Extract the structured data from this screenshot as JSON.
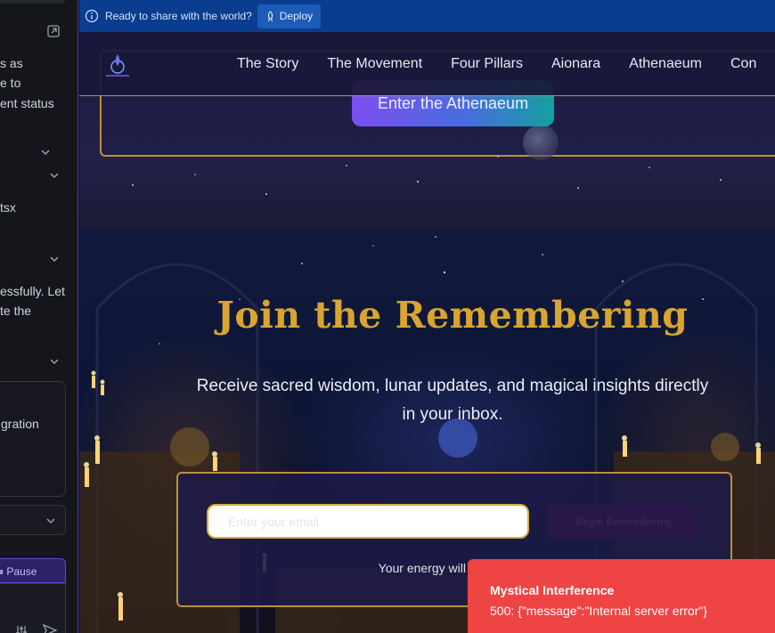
{
  "left_panel": {
    "lines": [
      "s as",
      "e to",
      "ent status",
      "tsx",
      "essfully. Let",
      "te the",
      "gration"
    ],
    "pause_label": "Pause"
  },
  "deploy_bar": {
    "ready_text": "Ready to share with the world?",
    "deploy_label": "Deploy"
  },
  "header": {
    "nav": [
      "The Story",
      "The Movement",
      "Four Pillars",
      "Aionara",
      "Athenaeum",
      "Con"
    ]
  },
  "upper_section": {
    "enter_button": "Enter the Athenaeum"
  },
  "join": {
    "title": "Join the Remembering",
    "subtitle": "Receive sacred wisdom, lunar updates, and magical insights directly in your inbox.",
    "email_placeholder": "Enter your email",
    "submit_label": "Begin Remembering",
    "note": "Your energy will be sent to i"
  },
  "toast": {
    "title": "Mystical Interference",
    "message": "500: {\"message\":\"Internal server error\"}",
    "color": "#ef4444"
  },
  "colors": {
    "gold": "#d9a530",
    "deploy_bar": "#0a3d8f",
    "panel_accent": "#5b45e0"
  }
}
